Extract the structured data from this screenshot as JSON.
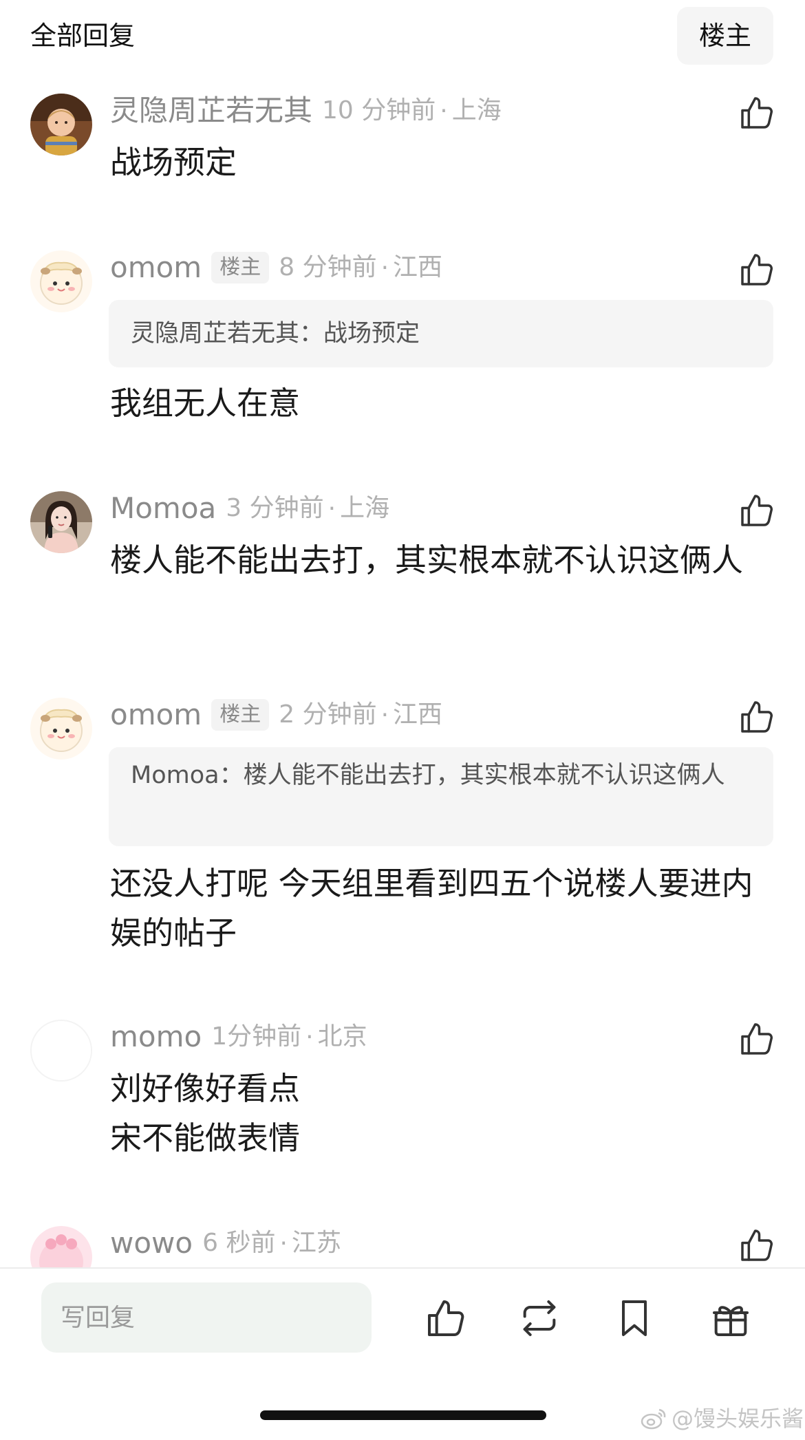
{
  "header": {
    "title": "全部回复",
    "op_filter_label": "楼主"
  },
  "comments": [
    {
      "username": "灵隐周芷若无其",
      "time": "10 分钟前",
      "separator": "·",
      "location": "上海",
      "text": "战场预定"
    },
    {
      "username": "omom",
      "op_tag": "楼主",
      "time": "8 分钟前",
      "separator": "·",
      "location": "江西",
      "quote": "灵隐周芷若无其：战场预定",
      "text": "我组无人在意"
    },
    {
      "username": "Momoa",
      "time": "3 分钟前",
      "separator": "·",
      "location": "上海",
      "text": "楼人能不能出去打，其实根本就不认识这俩人"
    },
    {
      "username": "omom",
      "op_tag": "楼主",
      "time": "2 分钟前",
      "separator": "·",
      "location": "江西",
      "quote": "Momoa：楼人能不能出去打，其实根本就不认识这俩人",
      "text": "还没人打呢 今天组里看到四五个说楼人要进内娱的帖子"
    },
    {
      "username": "momo",
      "time": "1分钟前",
      "separator": "·",
      "location": "北京",
      "text_line1": "刘好像好看点",
      "text_line2": "宋不能做表情"
    },
    {
      "username": "wowo",
      "time": "6 秒前",
      "separator": "·",
      "location": "江苏"
    }
  ],
  "bottom_bar": {
    "reply_placeholder": "写回复",
    "icons": [
      "thumbs-up-icon",
      "repost-icon",
      "bookmark-icon",
      "gift-icon"
    ]
  },
  "watermark": "@馒头娱乐酱",
  "colors": {
    "text_primary": "#1a1a1a",
    "text_secondary": "#8a8a8a",
    "text_tertiary": "#b0b0b0",
    "quote_bg": "#f5f5f5",
    "input_bg": "#f0f4f1"
  }
}
